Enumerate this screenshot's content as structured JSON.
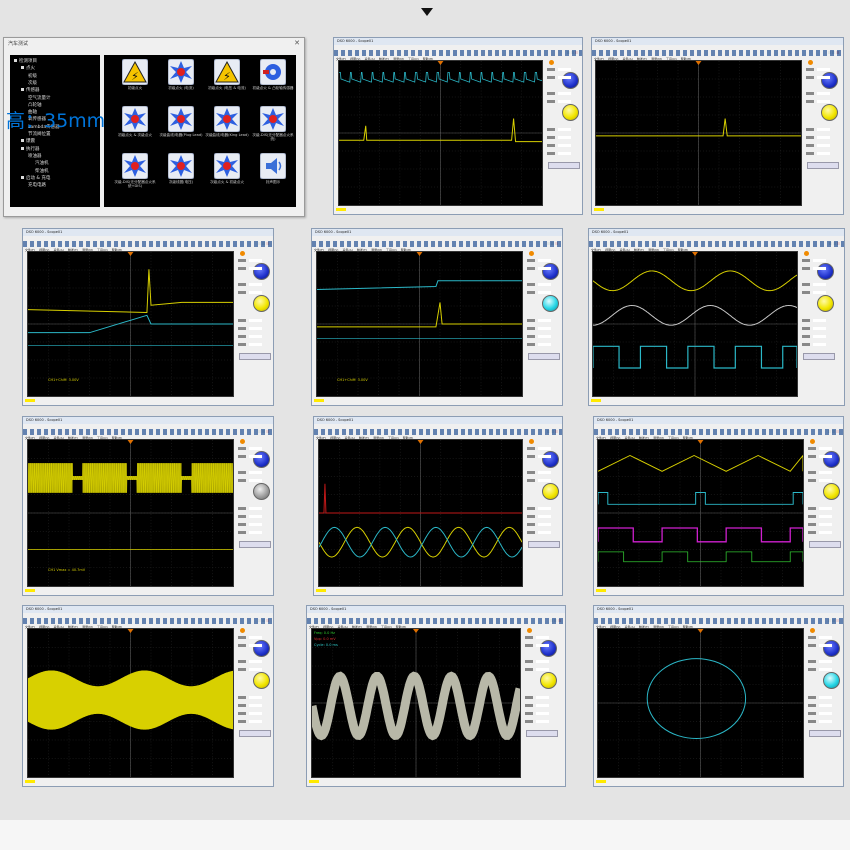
{
  "dialog": {
    "title": "汽车测试",
    "tree": [
      {
        "label": "检测项目",
        "level": 0
      },
      {
        "label": "点火",
        "level": 1
      },
      {
        "label": "初级",
        "level": 2
      },
      {
        "label": "次级",
        "level": 2
      },
      {
        "label": "传感器",
        "level": 1
      },
      {
        "label": "空气流量计",
        "level": 2
      },
      {
        "label": "凸轮轴",
        "level": 2
      },
      {
        "label": "曲轴",
        "level": 2
      },
      {
        "label": "氧传感器",
        "level": 2
      },
      {
        "label": "Lambda传感器",
        "level": 2
      },
      {
        "label": "节流阀位置",
        "level": 2
      },
      {
        "label": "爆震",
        "level": 1
      },
      {
        "label": "执行器",
        "level": 1
      },
      {
        "label": "喷油器",
        "level": 2
      },
      {
        "label": "汽油机",
        "level": 3
      },
      {
        "label": "柴油机",
        "level": 3
      },
      {
        "label": "启动 & 充电",
        "level": 1
      },
      {
        "label": "充电电路",
        "level": 2
      }
    ],
    "icons": [
      {
        "label": "初级点火",
        "kind": "warn",
        "icon": "ignition-warning-icon"
      },
      {
        "label": "初级点火 (电流)",
        "kind": "spark",
        "icon": "spark-icon"
      },
      {
        "label": "初级点火 (电压 & 电流)",
        "kind": "warn",
        "icon": "ignition-warning-icon"
      },
      {
        "label": "初级点火 & 凸轮轴传感器",
        "kind": "gear",
        "icon": "sensor-gear-icon"
      },
      {
        "label": "初级点火 & 次级点火",
        "kind": "spark",
        "icon": "spark-icon"
      },
      {
        "label": "次级曲线/电器(Plug Lead)",
        "kind": "spark",
        "icon": "spark-icon"
      },
      {
        "label": "次级曲线/电器(King Lead)",
        "kind": "spark",
        "icon": "spark-icon"
      },
      {
        "label": "次级-DIS(无分配器点火系统)",
        "kind": "spark",
        "icon": "spark-icon"
      },
      {
        "label": "次级-DIS(无分配器点火系统+DIS)",
        "kind": "spark",
        "icon": "spark-icon"
      },
      {
        "label": "次级线圈(电压)",
        "kind": "spark",
        "icon": "spark-icon"
      },
      {
        "label": "次级点火 & 初级点火",
        "kind": "spark",
        "icon": "spark-icon"
      },
      {
        "label": "铃声图示",
        "kind": "speaker",
        "icon": "speaker-icon"
      }
    ],
    "ok_label": "OK",
    "cancel_label": "Cancel"
  },
  "scope_windows": [
    {
      "id": "w1",
      "title": "DSO 6000 - Scope01",
      "channel_text": "",
      "knobs": [
        "blue",
        "yellow"
      ]
    },
    {
      "id": "w2",
      "title": "DSO 6000 - Scope01",
      "channel_text": "",
      "knobs": [
        "blue",
        "yellow"
      ]
    },
    {
      "id": "w3",
      "title": "DSO 6000 - Scope01",
      "channel_text": "CH1+Chiff: 3.00V",
      "knobs": [
        "blue",
        "yellow"
      ]
    },
    {
      "id": "w4",
      "title": "DSO 6000 - Scope01",
      "channel_text": "CH1+Chiff: 3.00V",
      "knobs": [
        "blue",
        "cyan"
      ]
    },
    {
      "id": "w5",
      "title": "DSO 6000 - Scope01",
      "channel_text": "",
      "knobs": [
        "blue",
        "yellow"
      ]
    },
    {
      "id": "w6",
      "title": "DSO 6000 - Scope01",
      "channel_text": "CH1 Vmax = 40.7mV",
      "knobs": [
        "blue",
        "gray"
      ]
    },
    {
      "id": "w7",
      "title": "DSO 6000 - Scope01",
      "channel_text": "",
      "knobs": [
        "blue",
        "yellow"
      ]
    },
    {
      "id": "w8",
      "title": "DSO 6000 - Scope01",
      "channel_text": "",
      "knobs": [
        "blue",
        "yellow"
      ]
    },
    {
      "id": "w9",
      "title": "DSO 6000 - Scope01",
      "channel_text": "",
      "knobs": [
        "blue",
        "yellow"
      ]
    },
    {
      "id": "w10",
      "title": "DSO 6000 - Scope01",
      "channel_text": "",
      "knobs": [
        "blue",
        "yellow"
      ]
    },
    {
      "id": "w11",
      "title": "DSO 6000 - Scope01",
      "channel_text": "",
      "knobs": [
        "blue",
        "cyan"
      ]
    }
  ],
  "menu_items": [
    "文件(F)",
    "视图(V)",
    "采集(A)",
    "触发(T)",
    "测量(M)",
    "工具(O)",
    "帮助(H)"
  ],
  "overlay_text": "高：35mm",
  "window10_readouts": [
    "Freq: 0.0 Hz",
    "Vpp: 0.0 mV",
    "Cycle: 0.0 ms"
  ],
  "colors": {
    "yellow_trace": "#d8d000",
    "cyan_trace": "#2bb8c8",
    "magenta_trace": "#d020d0",
    "red_trace": "#c01818",
    "gray_trace": "#b8b8a8",
    "overlay_text": "#0074d9"
  }
}
